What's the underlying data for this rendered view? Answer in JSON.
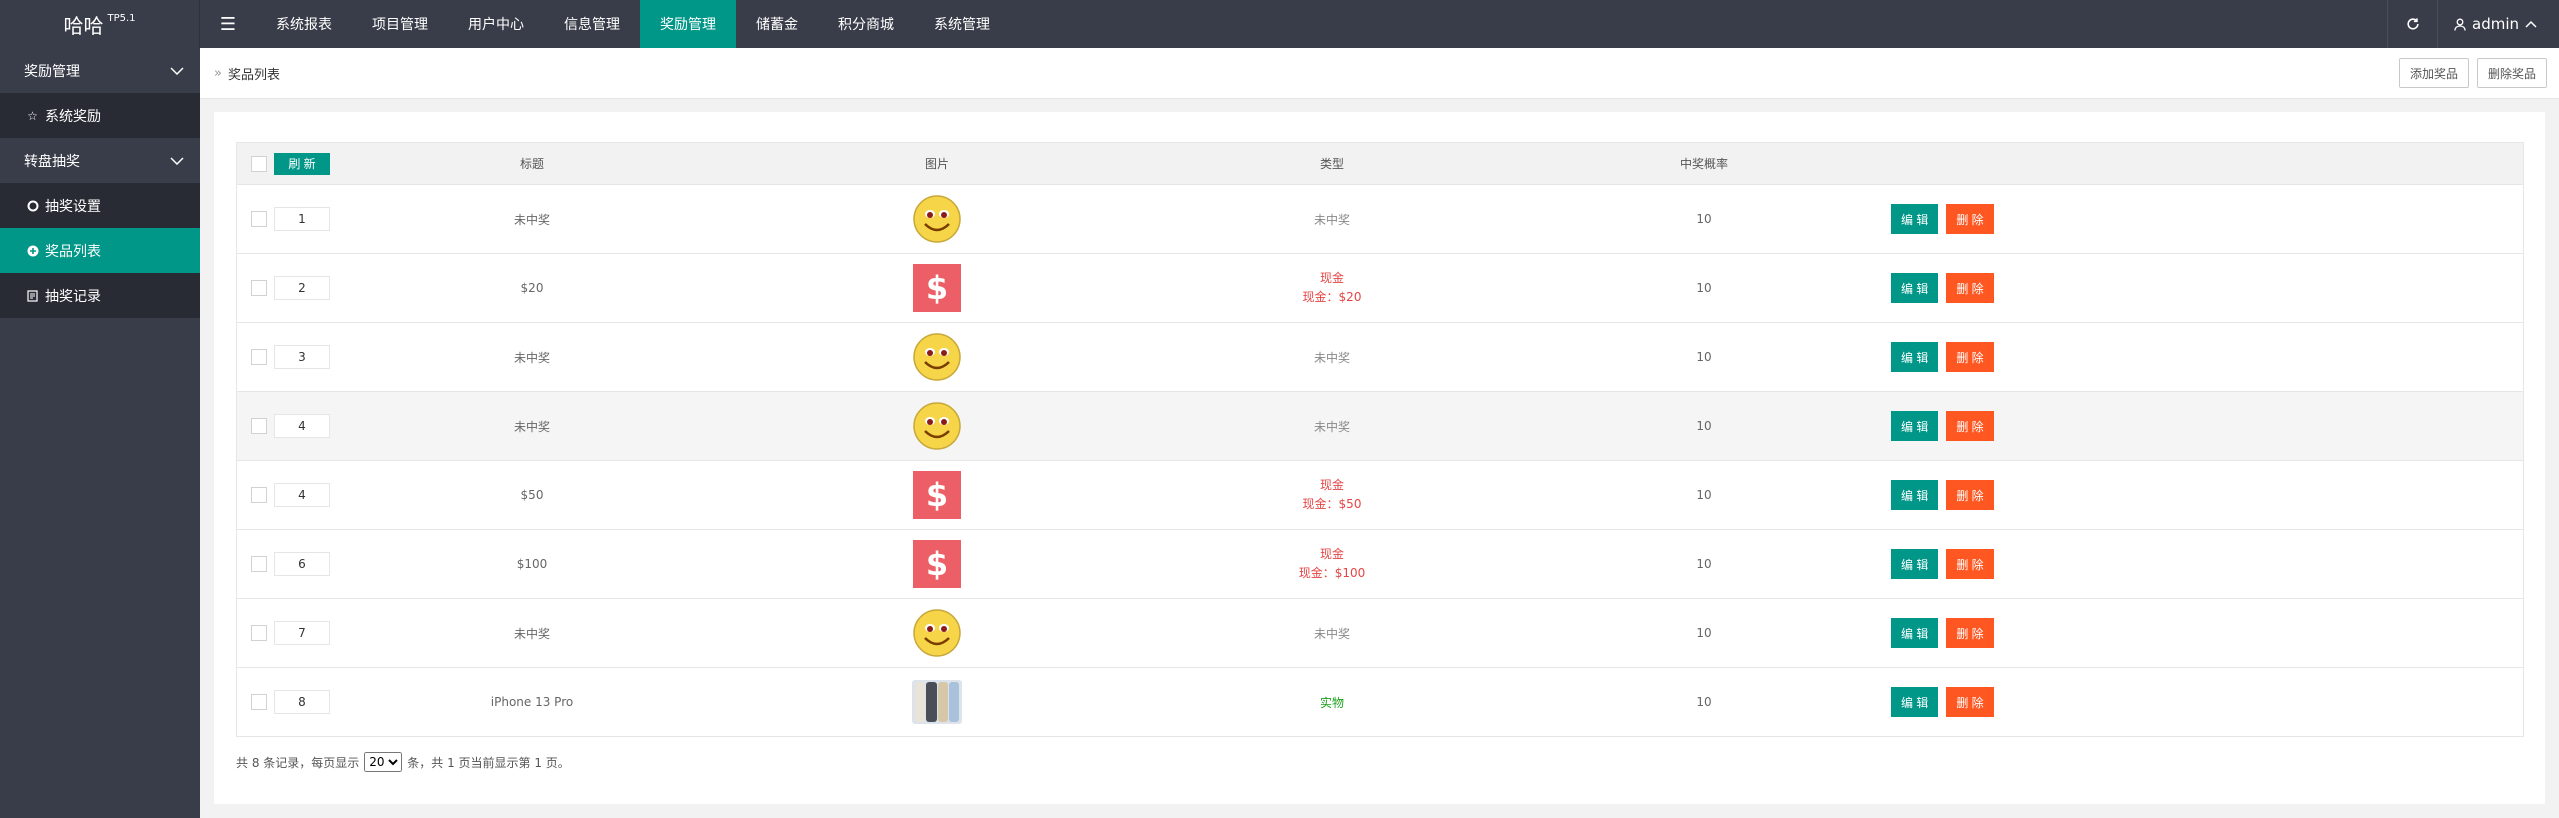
{
  "app": {
    "logo_text": "哈哈",
    "logo_sup": "TP5.1"
  },
  "topnav": {
    "toggle_icon": "menu-icon",
    "items": [
      "系统报表",
      "项目管理",
      "用户中心",
      "信息管理",
      "奖励管理",
      "储蓄金",
      "积分商城",
      "系统管理"
    ],
    "active_index": 4,
    "user": "admin",
    "refresh_icon": "refresh-icon"
  },
  "sidebar": {
    "group1": "奖励管理",
    "group1_items": [
      {
        "label": "系统奖励",
        "icon": "star-icon"
      }
    ],
    "group2": "转盘抽奖",
    "group2_items": [
      {
        "label": "抽奖设置",
        "icon": "circle-icon"
      },
      {
        "label": "奖品列表",
        "icon": "plus-circle-icon"
      },
      {
        "label": "抽奖记录",
        "icon": "document-icon"
      }
    ],
    "active_item": "奖品列表"
  },
  "breadcrumb": {
    "separator": "»",
    "current": "奖品列表"
  },
  "actions": {
    "add": "添加奖品",
    "delete": "删除奖品"
  },
  "table": {
    "headers": {
      "refresh": "刷 新",
      "title": "标题",
      "image": "图片",
      "type": "类型",
      "rate": "中奖概率"
    },
    "edit_label": "编 辑",
    "delete_label": "删 除",
    "rows": [
      {
        "sort": "1",
        "title": "未中奖",
        "image": "smiley",
        "type": "未中奖",
        "type_detail": "",
        "kind": "none",
        "rate": "10"
      },
      {
        "sort": "2",
        "title": "$20",
        "image": "dollar",
        "type": "现金",
        "type_detail": "现金：$20",
        "kind": "cash",
        "rate": "10"
      },
      {
        "sort": "3",
        "title": "未中奖",
        "image": "smiley",
        "type": "未中奖",
        "type_detail": "",
        "kind": "none",
        "rate": "10"
      },
      {
        "sort": "4",
        "title": "未中奖",
        "image": "smiley",
        "type": "未中奖",
        "type_detail": "",
        "kind": "none",
        "rate": "10"
      },
      {
        "sort": "4",
        "title": "$50",
        "image": "dollar",
        "type": "现金",
        "type_detail": "现金：$50",
        "kind": "cash",
        "rate": "10"
      },
      {
        "sort": "6",
        "title": "$100",
        "image": "dollar",
        "type": "现金",
        "type_detail": "现金：$100",
        "kind": "cash",
        "rate": "10"
      },
      {
        "sort": "7",
        "title": "未中奖",
        "image": "smiley",
        "type": "未中奖",
        "type_detail": "",
        "kind": "none",
        "rate": "10"
      },
      {
        "sort": "8",
        "title": "iPhone 13 Pro",
        "image": "phone",
        "type": "实物",
        "type_detail": "",
        "kind": "real",
        "rate": "10"
      }
    ]
  },
  "pager": {
    "prefix": "共 8 条记录，每页显示",
    "per_page": "20",
    "suffix": "条，共 1 页当前显示第 1 页。"
  },
  "colors": {
    "accent": "#009688",
    "danger": "#ff5722",
    "dark": "#393d49",
    "cash_red": "#e64545",
    "real_green": "#1aa01a"
  }
}
